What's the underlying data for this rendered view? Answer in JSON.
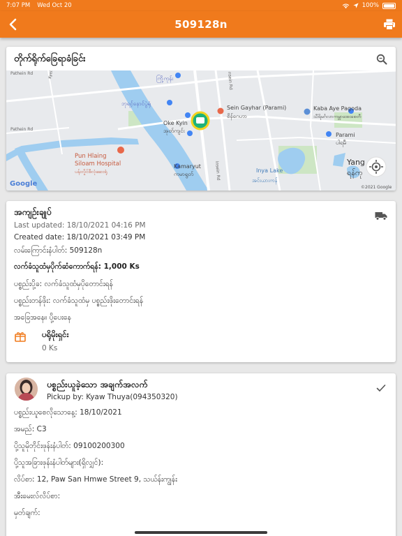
{
  "status_bar": {
    "time": "7:07 PM",
    "date": "Wed Oct 20",
    "battery": "100%"
  },
  "header": {
    "title": "509128n",
    "back_icon": "chevron-left-icon",
    "print_icon": "printer-icon",
    "color": "#f07a1c"
  },
  "map_card": {
    "title": "တိုက်ရိုက်ခြေရာခံခြင်း",
    "labels": {
      "kyeemyindaing": "ကြို့ကုန်း",
      "thuduna": "ဘုရင့်နောင်ပွဲရုံ",
      "sein_gayhar": "Sein Gayhar (Parami)",
      "sein_gayhar_my": "စိန်ဂေဟာ",
      "kaba_aye": "Kaba Aye Pagoda",
      "kaba_aye_my": "သီရိမင်္ဂလာကမ္ဘာအေးစေတီ",
      "oke_kyin": "Oke Kyin",
      "oke_kyin_my": "အုတ်ကျင်း",
      "parami": "Parami",
      "parami_my": "ပါရမီ",
      "pun_hlaing": "Pun Hlaing",
      "siloam": "Siloam Hospital",
      "pun_hlaing_my": "ပန်းလှိုင်စီလုံဆေးရုံ",
      "kamaryut": "Kamaryut",
      "kamaryut_my": "ကမာရွတ်",
      "inya_lake": "Inya Lake",
      "inya_lake_my": "အင်းယားကန်",
      "yangon": "Yang",
      "yangon_my": "ရန်ကု",
      "inseln_rd": "Insein Rd",
      "pathein_rd": "Pathein Rd",
      "google": "Google",
      "copyright": "©2021 Google"
    }
  },
  "info_card": {
    "title": "အကျဉ်းချုပ်",
    "last_updated": "Last updated: 18/10/2021 04:16 PM",
    "created": "Created date: 18/10/2021 03:49 PM",
    "tracking": "လမ်းကြောင်းနံပါတ်: 509128n",
    "fee": "လက်ခံသူထံမှပိုက်ဆံကောက်ရန်: 1,000 Ks",
    "origin": "ပစ္စည်းပို့ခ: လက်ခံသူထံမှပိုတောင်းရန်",
    "goods": "ပစ္စည်းတန်ဖိုး: လက်ခံသူထံမှ ပစ္စည်းဖိုးတောင်းရန်",
    "status": "အခြေအနေ။ ပို့ပေးနေ",
    "balance_label": "ပရိုမိုးရှင်း",
    "balance_value": "0 Ks"
  },
  "pickup_card": {
    "title": "ပစ္စည်းယူခဲ့သော အချက်အလက်",
    "pickup_by": "Pickup by: Kyaw Thuya(094350320)",
    "date": "ပစ္စည်းယူစေလိုသောနေ့: 18/10/2021",
    "name": "အမည်: C3",
    "phone": "ပို့သူမိုဘိုင်းဖုန်းနံပါတ်: 09100200300",
    "other_phone": "ပို့သူအခြားဖုန်းနံပါတ်များ(ရှိလျှင်):",
    "address": "လိပ်စာ: 12, Paw San Hmwe Street 9, သယ်န်းကျွန်း",
    "email": "အီးမေးလ်လိပ်စာ:",
    "note": "မှတ်ချက်:"
  }
}
